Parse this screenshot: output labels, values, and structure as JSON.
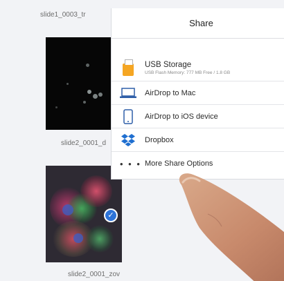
{
  "gallery": {
    "items": [
      {
        "label": "slide1_0003_tr"
      },
      {
        "label": "slide2_0001_d"
      },
      {
        "label": "slide2_0001_zov",
        "selected": true
      }
    ]
  },
  "share": {
    "title": "Share",
    "options": [
      {
        "label": "USB Storage",
        "sublabel": "USB Flash Memory: 777 MB Free / 1.8 GB",
        "icon": "usb-drive-icon"
      },
      {
        "label": "AirDrop to Mac",
        "icon": "laptop-icon"
      },
      {
        "label": "AirDrop to iOS device",
        "icon": "phone-icon"
      },
      {
        "label": "Dropbox",
        "icon": "dropbox-icon"
      },
      {
        "label": "More Share Options",
        "icon": "more-dots-icon"
      }
    ]
  },
  "colors": {
    "accent": "#2d73d8",
    "usb": "#f5a623",
    "dropbox": "#1f6fd0"
  }
}
